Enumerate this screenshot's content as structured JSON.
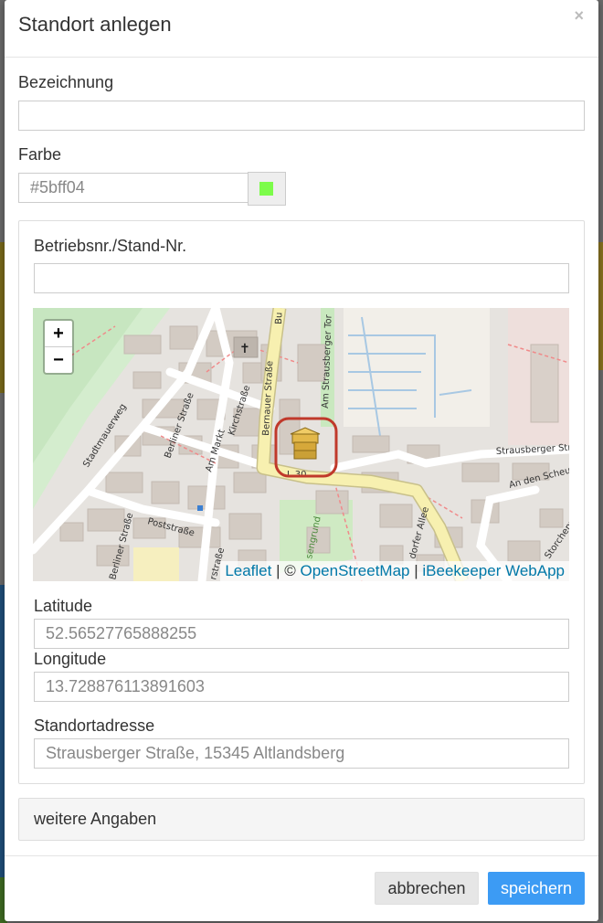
{
  "modal": {
    "title": "Standort anlegen",
    "close_label": "×"
  },
  "form": {
    "name_label": "Bezeichnung",
    "name_value": "",
    "color_label": "Farbe",
    "color_value": "#5bff04",
    "color_swatch": "#7cfc4a",
    "stand_label": "Betriebsnr./Stand-Nr.",
    "stand_value": "",
    "latitude_label": "Latitude",
    "latitude_value": "52.56527765888255",
    "longitude_label": "Longitude",
    "longitude_value": "13.728876113891603",
    "address_label": "Standortadresse",
    "address_value": "Strausberger Straße, 15345 Altlandsberg"
  },
  "map": {
    "zoom_in": "+",
    "zoom_out": "−",
    "attribution": {
      "leaflet": "Leaflet",
      "sep1": " | © ",
      "osm": "OpenStreetMap",
      "sep2": " | ",
      "app": "iBeekeeper WebApp"
    },
    "street_labels": {
      "stadtmauerweg": "Stadtmauerweg",
      "berliner1": "Berliner Straße",
      "am_markt": "Am Markt",
      "kirchstrasse": "Kirchstraße",
      "bernauer": "Bernauer Straße",
      "am_strausberger_tor": "Am Strausberger Tor",
      "strausberger": "Strausberger Straße",
      "an_den_scheunen": "An den Scheunen",
      "poststrasse": "Poststraße",
      "berliner2": "Berliner Straße",
      "storchenwiese": "Storchenwiese",
      "dorfer_allee": "dorfer Allee",
      "route": "L 30",
      "grund": "sengrund",
      "rstrasse": "rstraße",
      "bu": "Bu"
    },
    "marker_icon": "beehive-icon"
  },
  "accordion": {
    "label": "weitere Angaben"
  },
  "footer": {
    "cancel_label": "abbrechen",
    "save_label": "speichern"
  },
  "colors": {
    "primary": "#3c9bf4",
    "marker_ring": "#c0392b"
  }
}
